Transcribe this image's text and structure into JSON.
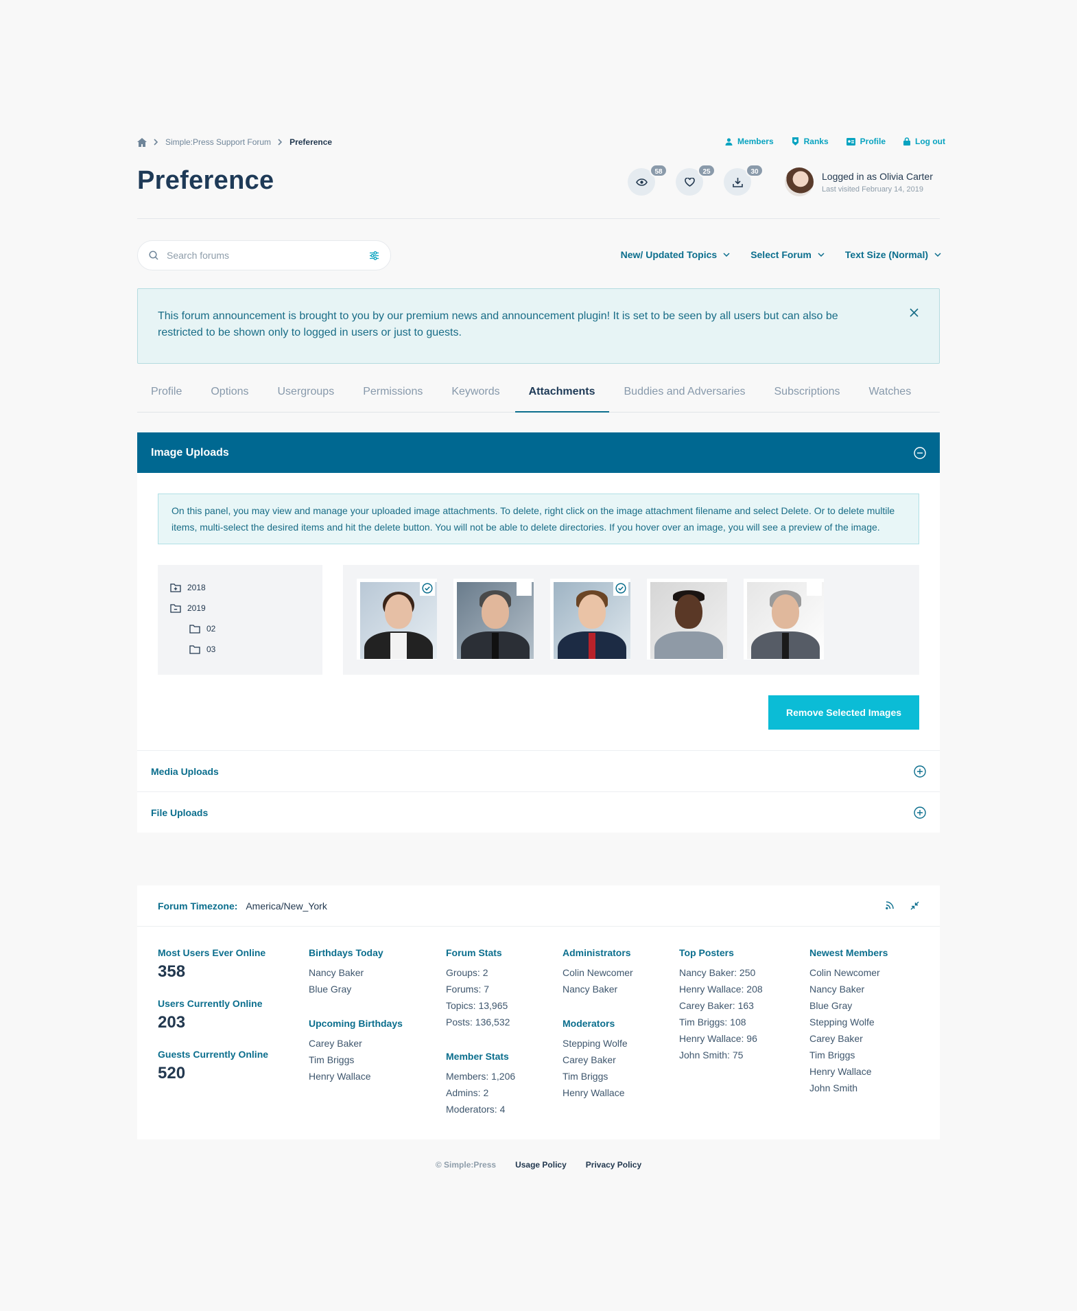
{
  "breadcrumb": {
    "items": [
      "Simple:Press Support Forum"
    ],
    "current": "Preference"
  },
  "toplinks": {
    "members": "Members",
    "ranks": "Ranks",
    "profile": "Profile",
    "logout": "Log out"
  },
  "page": {
    "title": "Preference"
  },
  "counters": {
    "views": "58",
    "likes": "25",
    "downloads": "30"
  },
  "user": {
    "logged_in": "Logged in as Olivia Carter",
    "last_visited": "Last visited February 14, 2019"
  },
  "search": {
    "placeholder": "Search forums"
  },
  "filters": {
    "topics": "New/ Updated Topics",
    "forum": "Select Forum",
    "text_size": "Text Size (Normal)"
  },
  "announcement": {
    "text": "This forum announcement is brought to you by our premium news and announcement plugin! It is set to be seen by all users but can also be restricted to be shown only to logged in users or just to guests."
  },
  "tabs": [
    "Profile",
    "Options",
    "Usergroups",
    "Permissions",
    "Keywords",
    "Attachments",
    "Buddies and Adversaries",
    "Subscriptions",
    "Watches"
  ],
  "active_tab": "Attachments",
  "panel": {
    "title": "Image Uploads",
    "info": "On this panel, you may view and manage your uploaded image attachments. To delete, right click on the image attachment filename and select Delete. Or to delete multile items, multi-select the desired items and hit the delete button. You will not be able to delete directories. If you hover over an image, you will see a preview of the image.",
    "tree": {
      "y2018": "2018",
      "y2019": "2019",
      "m02": "02",
      "m03": "03"
    },
    "images_selected": [
      true,
      false,
      true,
      false,
      false
    ],
    "remove_button": "Remove Selected Images"
  },
  "accordion": {
    "media": "Media Uploads",
    "files": "File Uploads"
  },
  "stats": {
    "timezone_label": "Forum Timezone:",
    "timezone_value": "America/New_York",
    "most_online_label": "Most Users Ever Online",
    "most_online": "358",
    "current_online_label": "Users Currently Online",
    "current_online": "203",
    "guests_online_label": "Guests Currently Online",
    "guests_online": "520",
    "birthdays_today_label": "Birthdays Today",
    "birthdays_today": [
      "Nancy Baker",
      "Blue Gray"
    ],
    "upcoming_label": "Upcoming Birthdays",
    "upcoming": [
      "Carey Baker",
      "Tim Briggs",
      "Henry Wallace"
    ],
    "forum_stats_label": "Forum Stats",
    "forum_stats": [
      "Groups: 2",
      "Forums: 7",
      "Topics: 13,965",
      "Posts: 136,532"
    ],
    "member_stats_label": "Member Stats",
    "member_stats": [
      "Members: 1,206",
      "Admins: 2",
      "Moderators: 4"
    ],
    "admins_label": "Administrators",
    "admins": [
      "Colin Newcomer",
      "Nancy Baker"
    ],
    "mods_label": "Moderators",
    "mods": [
      "Stepping Wolfe",
      "Carey Baker",
      "Tim Briggs",
      "Henry Wallace"
    ],
    "top_posters_label": "Top Posters",
    "top_posters": [
      "Nancy Baker: 250",
      "Henry Wallace: 208",
      "Carey Baker: 163",
      "Tim Briggs: 108",
      "Henry Wallace: 96",
      "John Smith: 75"
    ],
    "newest_label": "Newest Members",
    "newest": [
      "Colin Newcomer",
      "Nancy Baker",
      "Blue Gray",
      "Stepping Wolfe",
      "Carey Baker",
      "Tim Briggs",
      "Henry Wallace",
      "John Smith"
    ]
  },
  "footer": {
    "copyright": "© Simple:Press",
    "usage": "Usage Policy",
    "privacy": "Privacy Policy"
  },
  "colors": {
    "brand": "#006891",
    "accent": "#0bbcd6",
    "link": "#0b6e8d"
  }
}
